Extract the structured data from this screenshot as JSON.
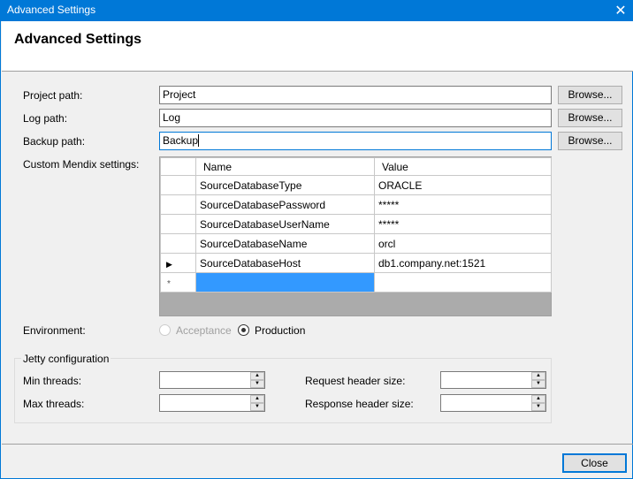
{
  "window": {
    "title": "Advanced Settings",
    "close_icon": "close-icon"
  },
  "header": {
    "heading": "Advanced Settings"
  },
  "paths": {
    "project": {
      "label": "Project path:",
      "value": "Project",
      "browse": "Browse..."
    },
    "log": {
      "label": "Log path:",
      "value": "Log",
      "browse": "Browse..."
    },
    "backup": {
      "label": "Backup path:",
      "value": "Backup",
      "browse": "Browse..."
    }
  },
  "custom_settings": {
    "label": "Custom Mendix settings:",
    "columns": [
      "Name",
      "Value"
    ],
    "rows": [
      {
        "name": "SourceDatabaseType",
        "value": "ORACLE",
        "marker": ""
      },
      {
        "name": "SourceDatabasePassword",
        "value": "*****",
        "marker": ""
      },
      {
        "name": "SourceDatabaseUserName",
        "value": "*****",
        "marker": ""
      },
      {
        "name": "SourceDatabaseName",
        "value": "orcl",
        "marker": ""
      },
      {
        "name": "SourceDatabaseHost",
        "value": "db1.company.net:1521",
        "marker": "▶"
      }
    ],
    "new_row_marker": "*"
  },
  "environment": {
    "label": "Environment:",
    "options": [
      {
        "label": "Acceptance",
        "selected": false,
        "enabled": false
      },
      {
        "label": "Production",
        "selected": true,
        "enabled": true
      }
    ]
  },
  "jetty": {
    "legend": "Jetty configuration",
    "min_threads": {
      "label": "Min threads:",
      "value": ""
    },
    "max_threads": {
      "label": "Max threads:",
      "value": ""
    },
    "request_header_size": {
      "label": "Request header size:",
      "value": ""
    },
    "response_header_size": {
      "label": "Response header size:",
      "value": ""
    }
  },
  "footer": {
    "close_label": "Close"
  },
  "colors": {
    "accent": "#0078d7",
    "selection": "#3399ff",
    "grid_background": "#ababab"
  }
}
